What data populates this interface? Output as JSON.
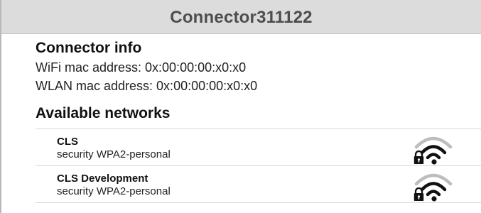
{
  "window": {
    "title": "Connector311122"
  },
  "connector_info": {
    "heading": "Connector info",
    "wifi_mac_line": "WiFi mac address: 0x:00:00:00:x0:x0",
    "wlan_mac_line": "WLAN mac address: 0x:00:00:00:x0:x0"
  },
  "available_networks": {
    "heading": "Available networks",
    "items": [
      {
        "name": "CLS",
        "security": "security WPA2-personal",
        "icon": "wifi-locked-icon"
      },
      {
        "name": "CLS Development",
        "security": "security WPA2-personal",
        "icon": "wifi-locked-icon"
      }
    ]
  }
}
